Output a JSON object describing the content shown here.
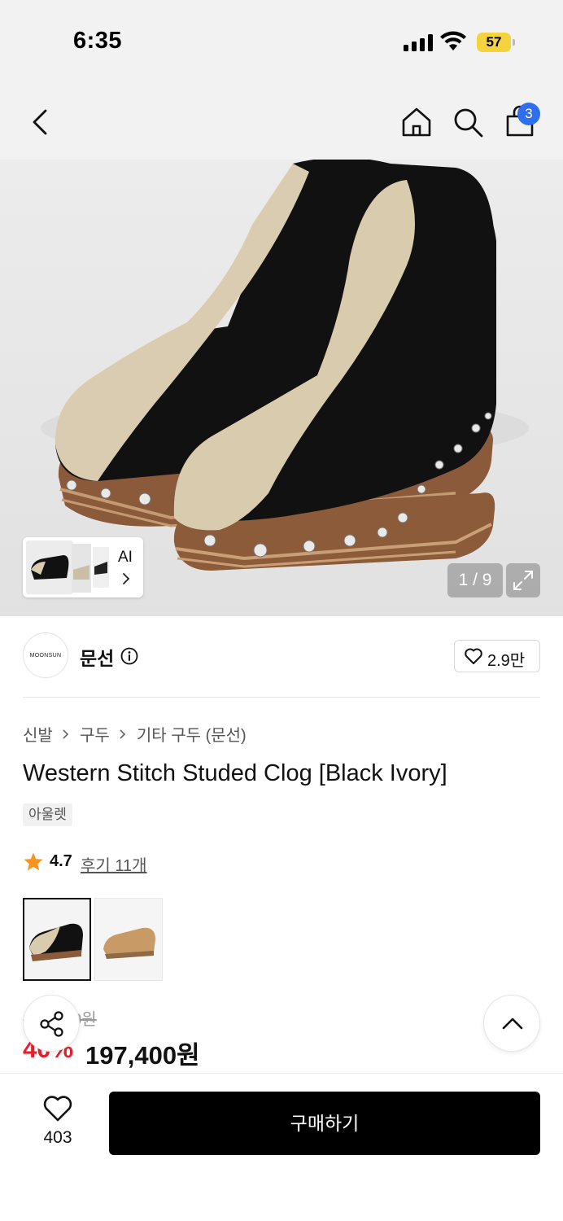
{
  "status_bar": {
    "time": "6:35",
    "battery": "57"
  },
  "nav": {
    "back_icon": "chevron-left-icon",
    "home_icon": "home-icon",
    "search_icon": "search-icon",
    "cart_icon": "shopping-bag-icon",
    "cart_count": "3"
  },
  "gallery": {
    "ai_label": "AI",
    "counter": "1 / 9",
    "expand_icon": "expand-icon"
  },
  "brand": {
    "logo_text": "MOONSUN",
    "name": "문선",
    "likes": "2.9만"
  },
  "breadcrumb": [
    "신발",
    "구두",
    "기타 구두 (문선)"
  ],
  "product": {
    "title": "Western Stitch Studed Clog [Black Ivory]",
    "badge": "아울렛",
    "rating": "4.7",
    "reviews": "후기 11개",
    "original_price": "329,000원",
    "discount": "40%",
    "price": "197,400원"
  },
  "colors": {
    "accent": "#e5202b",
    "badge_blue": "#2f6fee",
    "battery_yellow": "#f5d33f"
  },
  "bottom_bar": {
    "wish_count": "403",
    "buy_label": "구매하기"
  }
}
